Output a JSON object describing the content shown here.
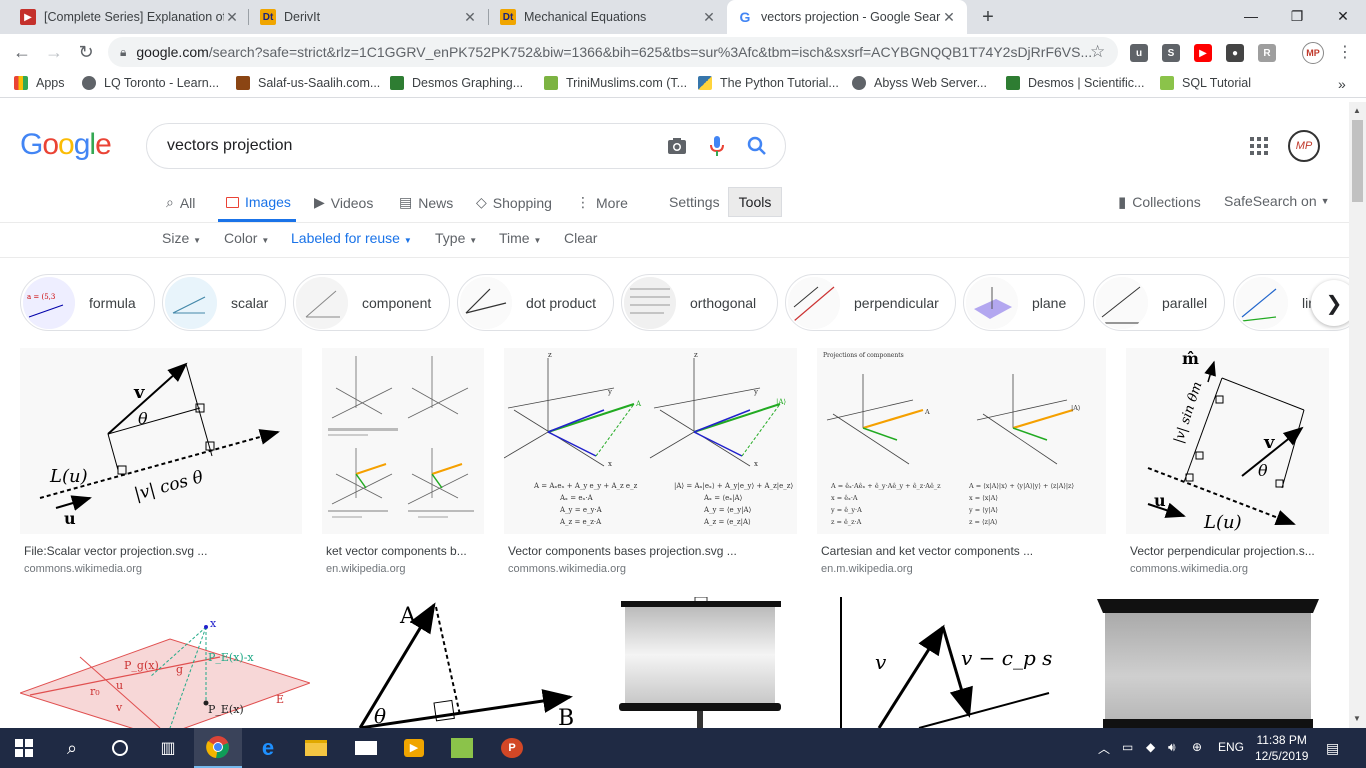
{
  "browser": {
    "tabs": [
      {
        "title": "[Complete Series] Explanation of",
        "favicon_color": "#c4302b"
      },
      {
        "title": "DerivIt",
        "favicon_color": "#f0a500"
      },
      {
        "title": "Mechanical Equations",
        "favicon_color": "#f0a500"
      },
      {
        "title": "vectors projection - Google Sear",
        "favicon_color": "#4285f4"
      }
    ],
    "active_tab": 3,
    "new_tab": "+",
    "window_controls": {
      "minimize": "—",
      "maximize": "❐",
      "close": "✕"
    },
    "url_host": "google.com",
    "url_path": "/search?safe=strict&rlz=1C1GGRV_enPK752PK752&biw=1366&bih=625&tbs=sur%3Afc&tbm=isch&sxsrf=ACYBGNQQB1T74Y2sDjRrF6VS...",
    "bookmarks": [
      {
        "label": "Apps",
        "color": "#4285f4"
      },
      {
        "label": "LQ Toronto - Learn...",
        "color": "#5f6368"
      },
      {
        "label": "Salaf-us-Saalih.com...",
        "color": "#8b4513"
      },
      {
        "label": "Desmos Graphing...",
        "color": "#2e7d32"
      },
      {
        "label": "TriniMuslims.com (T...",
        "color": "#7cb342"
      },
      {
        "label": "The Python Tutorial...",
        "color": "#3776ab"
      },
      {
        "label": "Abyss Web Server...",
        "color": "#5f6368"
      },
      {
        "label": "Desmos | Scientific...",
        "color": "#2e7d32"
      },
      {
        "label": "SQL Tutorial",
        "color": "#8bc34a"
      }
    ],
    "bookmarks_more": "»"
  },
  "google": {
    "logo": [
      "G",
      "o",
      "o",
      "g",
      "l",
      "e"
    ],
    "logo_colors": [
      "#4285f4",
      "#ea4335",
      "#fbbc05",
      "#4285f4",
      "#34a853",
      "#ea4335"
    ],
    "query": "vectors projection",
    "avatar_initials": "MP",
    "nav": [
      {
        "label": "All",
        "icon": "search-icon"
      },
      {
        "label": "Images",
        "icon": "image-icon"
      },
      {
        "label": "Videos",
        "icon": "video-icon"
      },
      {
        "label": "News",
        "icon": "news-icon"
      },
      {
        "label": "Shopping",
        "icon": "tag-icon"
      },
      {
        "label": "More",
        "icon": "dots-vertical-icon"
      }
    ],
    "settings_label": "Settings",
    "tools_label": "Tools",
    "collections_label": "Collections",
    "safesearch_label": "SafeSearch on",
    "tools": [
      "Size",
      "Color",
      "Labeled for reuse",
      "Type",
      "Time",
      "Clear"
    ],
    "chips": [
      "formula",
      "scalar",
      "component",
      "dot product",
      "orthogonal",
      "perpendicular",
      "plane",
      "parallel",
      "lin"
    ],
    "results_row1": [
      {
        "title": "File:Scalar vector projection.svg ...",
        "source": "commons.wikimedia.org"
      },
      {
        "title": "ket vector components b...",
        "source": "en.wikipedia.org"
      },
      {
        "title": "Vector components bases projection.svg ...",
        "source": "commons.wikimedia.org"
      },
      {
        "title": "Cartesian and ket vector components ...",
        "source": "en.m.wikipedia.org"
      },
      {
        "title": "Vector perpendicular projection.s...",
        "source": "commons.wikimedia.org"
      }
    ]
  },
  "figures": {
    "scalar_proj": {
      "v": "v",
      "theta": "θ",
      "L": "L(u)",
      "u": "u",
      "vcos": "|v| cos θ"
    },
    "vec_comp": {
      "A": "A",
      "Aexpr": "A = Aₓeₓ + A_y e_y + A_z e_z",
      "Ax": "Aₓ = eₓ·A",
      "Ay": "A_y = e_y·A",
      "Az": "A_z = e_z·A",
      "ketexpr": "|A⟩ = Aₓ|eₓ⟩ + A_y|e_y⟩ + A_z|e_z⟩",
      "kx": "Aₓ = ⟨eₓ|A⟩",
      "ky": "A_y = ⟨e_y|A⟩",
      "kz": "A_z = ⟨e_z|A⟩",
      "z": "z",
      "x": "x",
      "y": "y",
      "ket": "|A⟩"
    },
    "cartesian": {
      "heading": "Projections of components",
      "expr": "A = êₓ·Aêₓ + ê_y·Aê_y + ê_z·Aê_z",
      "x": "x = êₓ·A",
      "y": "y = ê_y·A",
      "z": "z = ê_z·A",
      "ketexpr": "A = ⟨x|A⟩|x⟩ + ⟨y|A⟩|y⟩ + ⟨z|A⟩|z⟩",
      "kx": "x = ⟨x|A⟩",
      "ky": "y = ⟨y|A⟩",
      "kz": "z = ⟨z|A⟩"
    },
    "perp": {
      "m": "m̂",
      "msin": "|v| sin θm",
      "v": "v",
      "theta": "θ",
      "u": "u",
      "L": "L(u)"
    },
    "plane": {
      "x": "x",
      "pe": "P_E(x)-x",
      "pg": "P_g(x)",
      "g": "g",
      "r0": "r₀",
      "u": "u",
      "v": "v",
      "pex": "P_E(x)",
      "E": "E"
    },
    "ab": {
      "A": "A",
      "theta": "θ",
      "B": "B"
    },
    "vcs": {
      "v": "v",
      "vcs": "v − c_p s"
    }
  },
  "taskbar": {
    "time": "11:38 PM",
    "date": "12/5/2019",
    "lang": "ENG"
  }
}
